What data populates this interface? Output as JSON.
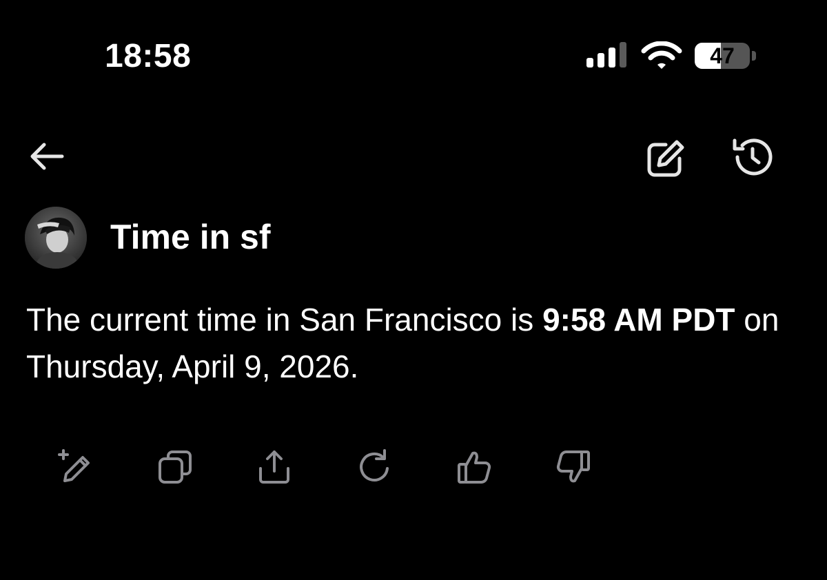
{
  "status_bar": {
    "time": "18:58",
    "battery_level": "47",
    "battery_fraction": 0.47,
    "icons": [
      "signal-icon",
      "wifi-icon",
      "battery-icon"
    ]
  },
  "nav": {
    "icons": [
      "back-arrow-icon",
      "new-chat-icon",
      "history-icon"
    ]
  },
  "chat": {
    "title": "Time in sf"
  },
  "message": {
    "intro": "The current time in San Francisco is ",
    "time_bold": "9:58 AM PDT",
    "outro": " on Thursday, April 9, 2026."
  },
  "actions": {
    "icons": [
      "edit-pencil-plus-icon",
      "copy-icon",
      "share-icon",
      "regenerate-icon",
      "thumbs-up-icon",
      "thumbs-down-icon"
    ]
  },
  "colors": {
    "background": "#000000",
    "text": "#ffffff",
    "nav_icon": "#e6e6e6",
    "action_icon": "#8e8e93"
  }
}
